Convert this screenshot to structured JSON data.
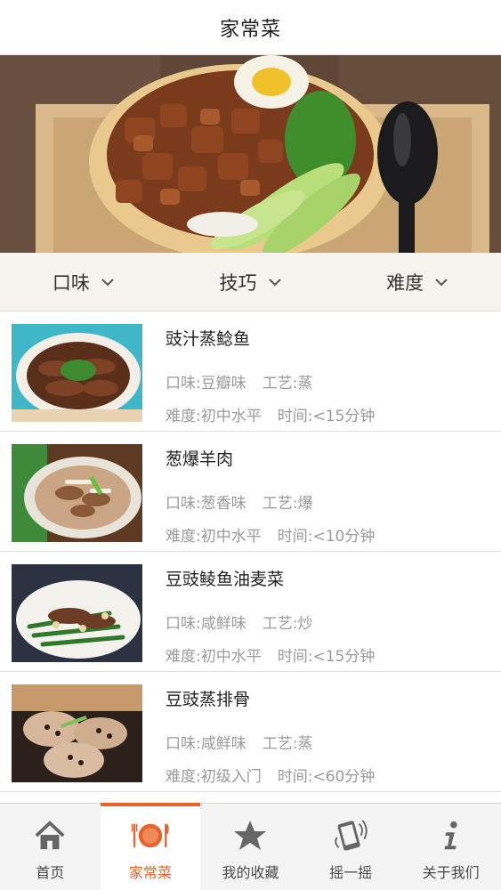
{
  "header": {
    "title": "家常菜"
  },
  "filters": [
    {
      "label": "口味"
    },
    {
      "label": "技巧"
    },
    {
      "label": "难度"
    }
  ],
  "recipes": [
    {
      "name": "豉汁蒸鲶鱼",
      "flavor": "口味:豆瓣味",
      "craft": "工艺:蒸",
      "difficulty": "难度:初中水平",
      "time": "时间:<15分钟"
    },
    {
      "name": "葱爆羊肉",
      "flavor": "口味:葱香味",
      "craft": "工艺:爆",
      "difficulty": "难度:初中水平",
      "time": "时间:<10分钟"
    },
    {
      "name": "豆豉鲮鱼油麦菜",
      "flavor": "口味:咸鲜味",
      "craft": "工艺:炒",
      "difficulty": "难度:初中水平",
      "time": "时间:<15分钟"
    },
    {
      "name": "豆豉蒸排骨",
      "flavor": "口味:咸鲜味",
      "craft": "工艺:蒸",
      "difficulty": "难度:初级入门",
      "time": "时间:<60分钟"
    }
  ],
  "tabs": [
    {
      "label": "首页",
      "icon": "home-icon"
    },
    {
      "label": "家常菜",
      "icon": "plate-utensils-icon",
      "active": true
    },
    {
      "label": "我的收藏",
      "icon": "star-icon"
    },
    {
      "label": "摇一摇",
      "icon": "shake-phone-icon"
    },
    {
      "label": "关于我们",
      "icon": "info-icon"
    }
  ],
  "colors": {
    "accent": "#e8632b",
    "filter_bg": "#f7f3ef",
    "tabbar_bg": "#f4f4f4"
  }
}
